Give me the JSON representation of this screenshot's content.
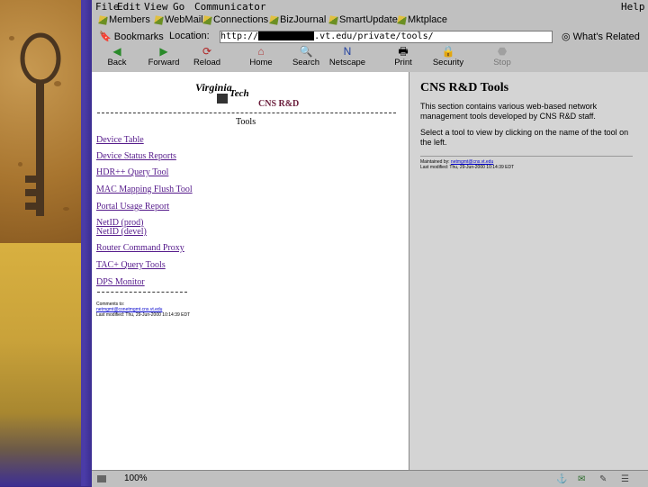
{
  "menu": {
    "items": [
      "File",
      "Edit",
      "View",
      "Go",
      "Communicator"
    ],
    "help": "Help"
  },
  "personal_toolbar": [
    "Members",
    "WebMail",
    "Connections",
    "BizJournal",
    "SmartUpdate",
    "Mktplace"
  ],
  "location_bar": {
    "bookmarks_label": "Bookmarks",
    "location_label": "Location:",
    "url_prefix": "http://",
    "url_suffix": ".vt.edu/private/tools/",
    "whats_related": "What's Related"
  },
  "nav_toolbar": [
    "Back",
    "Forward",
    "Reload",
    "Home",
    "Search",
    "Netscape",
    "Print",
    "Security",
    "Stop"
  ],
  "page": {
    "logo_virginia": "Virginia",
    "logo_tech": "Tech",
    "header": "CNS R&D",
    "tools_heading": "Tools",
    "links": [
      "Device Table",
      "Device Status Reports",
      "HDR++ Query Tool",
      "MAC Mapping Flush Tool",
      "Portal Usage Report",
      "NetID (prod)",
      "NetID (devel)",
      "Router Command Proxy",
      "TAC+ Query Tools",
      "DPS Monitor"
    ],
    "footer_line1": "Comments to:",
    "footer_link": "netmgmt@conetmgmt.cns.vt.edu",
    "footer_line2": "Last modified: Thu, 29-Jun-2000 10:14:39 EDT"
  },
  "right_pane": {
    "title": "CNS R&D Tools",
    "para1": "This section contains various web-based network management tools developed by CNS R&D staff.",
    "para2": "Select a tool to view by clicking on the name of the tool on the left.",
    "footer_line1": "Maintained by:",
    "footer_link": "netmgmt@cns.vt.edu",
    "footer_line2": "Last modified: Thu, 29-Jun-2000 10:14:39 EDT"
  },
  "status_bar": {
    "percent": "100%"
  },
  "colors": {
    "link_visited": "#551a8b",
    "header_maroon": "#6a1c3a",
    "background_purple": "#3d2f93"
  }
}
